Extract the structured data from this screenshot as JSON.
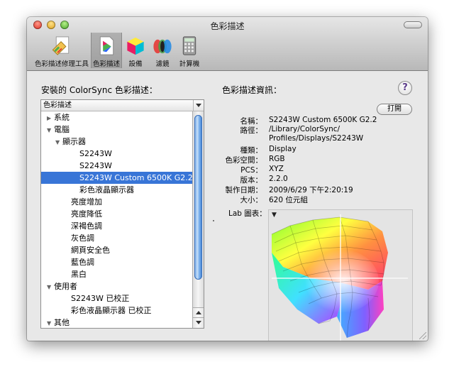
{
  "window": {
    "title": "色彩描述"
  },
  "toolbar": [
    {
      "name": "tool-colorsync-utility",
      "label": "色彩描述修理工具",
      "icon": "repair-icon",
      "selected": false
    },
    {
      "name": "tool-profiles",
      "label": "色彩描述",
      "icon": "profile-icon",
      "selected": true
    },
    {
      "name": "tool-devices",
      "label": "設備",
      "icon": "device-cube-icon",
      "selected": false
    },
    {
      "name": "tool-filters",
      "label": "濾鏡",
      "icon": "filters-icon",
      "selected": false
    },
    {
      "name": "tool-calculator",
      "label": "計算機",
      "icon": "calculator-icon",
      "selected": false
    }
  ],
  "left": {
    "heading": "安裝的 ColorSync 色彩描述：",
    "dropdown_value": "色彩描述",
    "rows": [
      {
        "text": "系統",
        "indent": 0,
        "tri": "▶",
        "selected": false
      },
      {
        "text": "電腦",
        "indent": 0,
        "tri": "▼",
        "selected": false
      },
      {
        "text": "顯示器",
        "indent": 1,
        "tri": "▼",
        "selected": false
      },
      {
        "text": "S2243W",
        "indent": 3,
        "tri": "",
        "selected": false
      },
      {
        "text": "S2243W",
        "indent": 3,
        "tri": "",
        "selected": false
      },
      {
        "text": "S2243W Custom 6500K G2.2",
        "indent": 3,
        "tri": "",
        "selected": true
      },
      {
        "text": "彩色液晶顯示器",
        "indent": 3,
        "tri": "",
        "selected": false
      },
      {
        "text": "亮度增加",
        "indent": 2,
        "tri": "",
        "selected": false
      },
      {
        "text": "亮度降低",
        "indent": 2,
        "tri": "",
        "selected": false
      },
      {
        "text": "深褐色調",
        "indent": 2,
        "tri": "",
        "selected": false
      },
      {
        "text": "灰色調",
        "indent": 2,
        "tri": "",
        "selected": false
      },
      {
        "text": "網頁安全色",
        "indent": 2,
        "tri": "",
        "selected": false
      },
      {
        "text": "藍色調",
        "indent": 2,
        "tri": "",
        "selected": false
      },
      {
        "text": "黑白",
        "indent": 2,
        "tri": "",
        "selected": false
      },
      {
        "text": "使用者",
        "indent": 0,
        "tri": "▼",
        "selected": false
      },
      {
        "text": "S2243W 已校正",
        "indent": 2,
        "tri": "",
        "selected": false
      },
      {
        "text": "彩色液晶顯示器 已校正",
        "indent": 2,
        "tri": "",
        "selected": false
      },
      {
        "text": "其他",
        "indent": 0,
        "tri": "▼",
        "selected": false
      }
    ]
  },
  "right": {
    "heading": "色彩描述資訊：",
    "help_label": "?",
    "open_button": "打開",
    "info": [
      {
        "key": "名稱：",
        "value": "S2243W Custom 6500K G2.2"
      },
      {
        "key": "路徑：",
        "value": "/Library/ColorSync/"
      },
      {
        "key": "",
        "value": "Profiles/Displays/S2243W"
      },
      {
        "key": "種類：",
        "value": "Display"
      },
      {
        "key": "色彩空間：",
        "value": "RGB"
      },
      {
        "key": "PCS：",
        "value": "XYZ"
      },
      {
        "key": "版本：",
        "value": "2.2.0"
      },
      {
        "key": "製作日期：",
        "value": "2009/6/29 下午2:20:19"
      },
      {
        "key": "大小：",
        "value": "620 位元組"
      }
    ],
    "lab_label": "Lab 圖表：",
    "lab_menu_icon": "▼"
  },
  "colors": {
    "selection": "#3875d7",
    "scroll_thumb": "#6aa3e6"
  }
}
